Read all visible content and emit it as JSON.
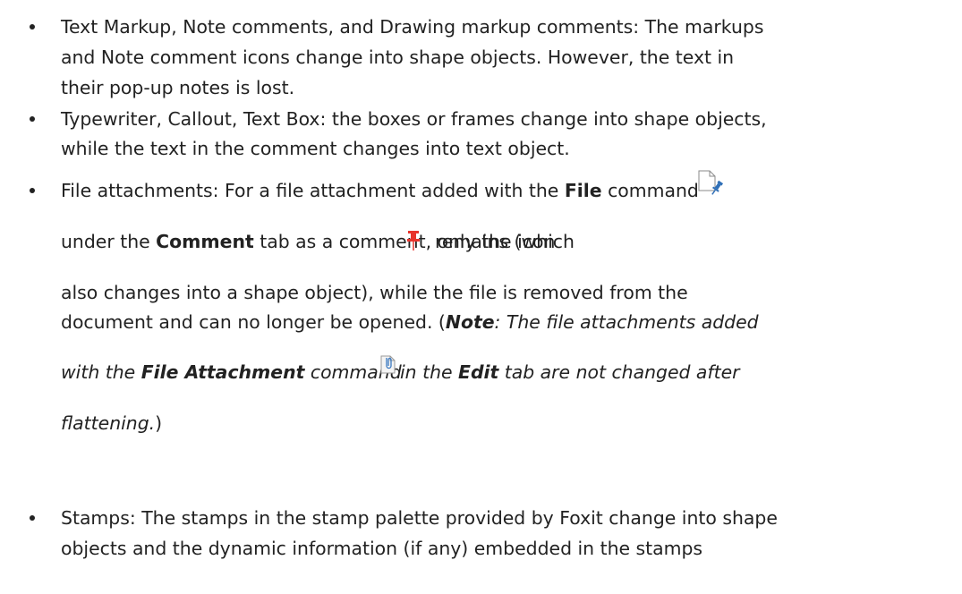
{
  "bullets": [
    {
      "lines": [
        "Text Markup, Note comments, and Drawing markup comments: The markups",
        "and Note comment icons change into shape objects. However, the text in",
        "their pop-up notes is lost."
      ]
    },
    {
      "lines": [
        "Typewriter, Callout, Text Box: the boxes or frames change into shape objects,",
        "while the text in the comment changes into text object."
      ]
    },
    {
      "line1": {
        "a": "File attachments: For a file attachment added with the ",
        "b": "File",
        "c": " command"
      },
      "line2": {
        "a": "under the ",
        "b": "Comment",
        "c": " tab as a comment, only the icon",
        "d": "remains (which"
      },
      "line3": "also changes into a shape object), while the file is removed from the",
      "line4": {
        "a": "document and can no longer be opened. (",
        "b": "Note",
        "c": ": The file attachments added"
      },
      "line5": {
        "a": "with the ",
        "b": "File Attachment",
        "c": " command",
        "d": " in the ",
        "e": "Edit",
        "f": " tab are not changed after"
      },
      "line6": {
        "a": "flattening.",
        "b": ")"
      }
    },
    {
      "lines": [
        "Stamps: The stamps in the stamp palette provided by Foxit change into shape",
        "objects and the dynamic information (if any) embedded in the stamps"
      ]
    }
  ],
  "icons": {
    "file_command": "file-attach-comment-icon",
    "pushpin": "pushpin-icon",
    "file_attachment_command": "paperclip-file-attachment-icon",
    "pushpin_color": "#e8342c",
    "file_pin_color": "#2f6fb7"
  }
}
